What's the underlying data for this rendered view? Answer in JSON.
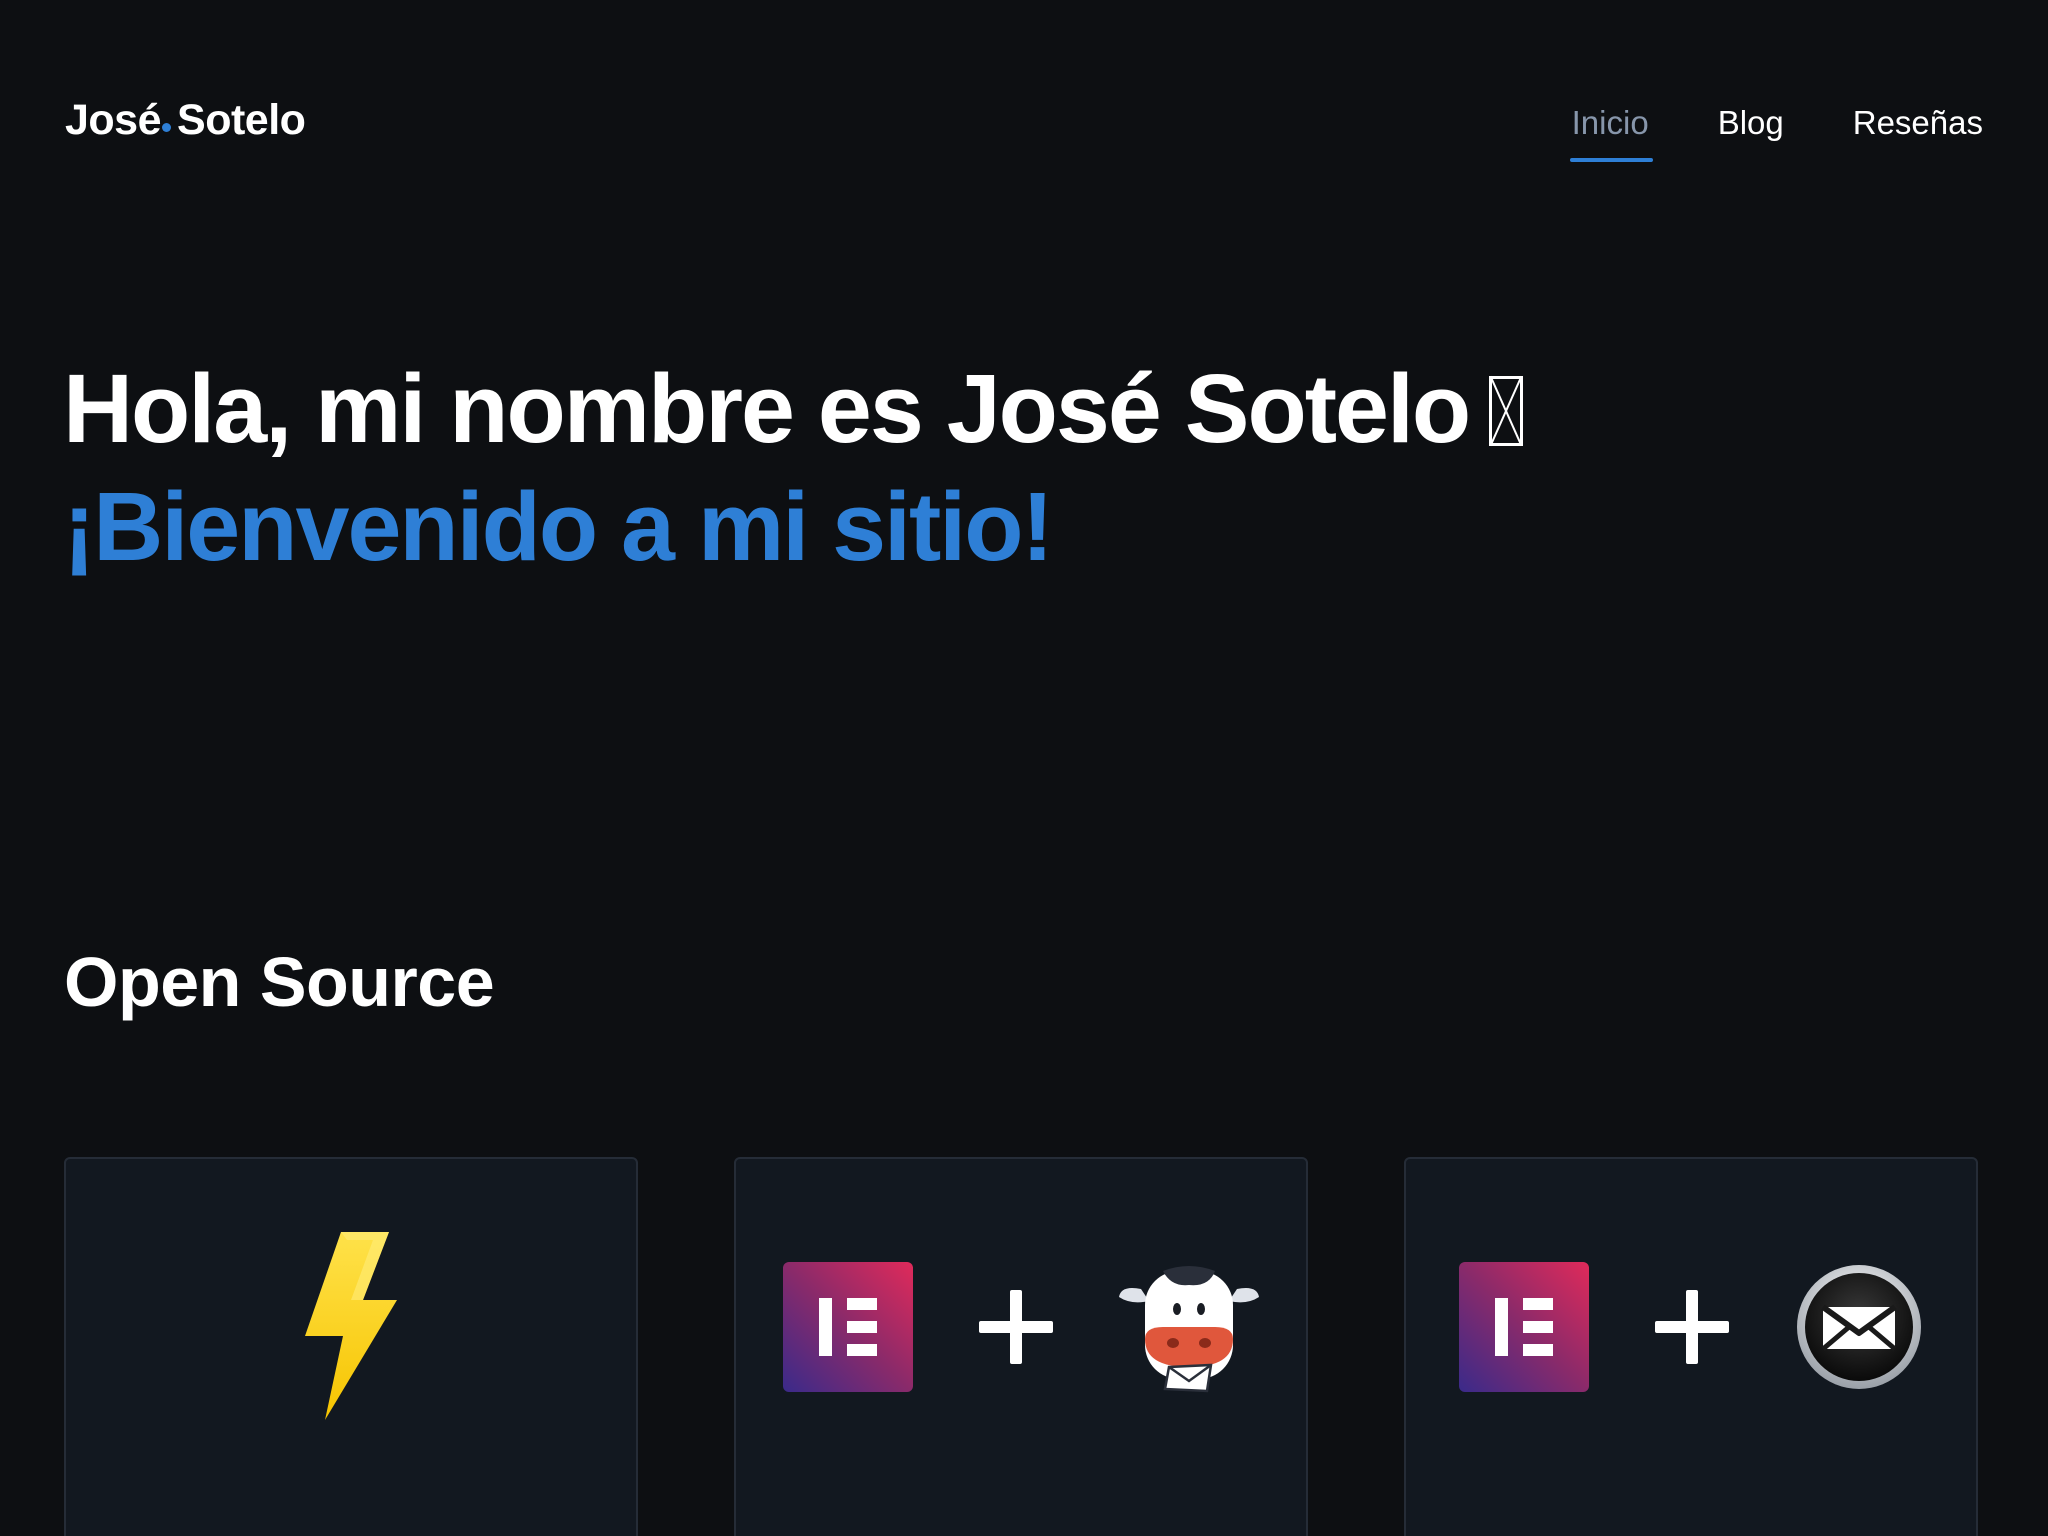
{
  "header": {
    "logo_first": "José",
    "logo_second": "Sotelo",
    "logo_dot_color": "#2e7fd6",
    "nav": [
      {
        "label": "Inicio",
        "active": true
      },
      {
        "label": "Blog",
        "active": false
      },
      {
        "label": "Reseñas",
        "active": false
      }
    ]
  },
  "hero": {
    "greeting": "Hola, mi nombre es José Sotelo",
    "emoji_icon": "missing-glyph-box",
    "welcome": "¡Bienvenido a mi sitio!",
    "accent_color": "#2e7fd6"
  },
  "open_source": {
    "title": "Open Source",
    "cards": [
      {
        "icons": [
          "lightning-bolt-icon"
        ]
      },
      {
        "icons": [
          "elementor-icon",
          "plus-icon",
          "cow-mail-icon"
        ]
      },
      {
        "icons": [
          "elementor-icon",
          "plus-icon",
          "envelope-circle-icon"
        ]
      }
    ]
  }
}
